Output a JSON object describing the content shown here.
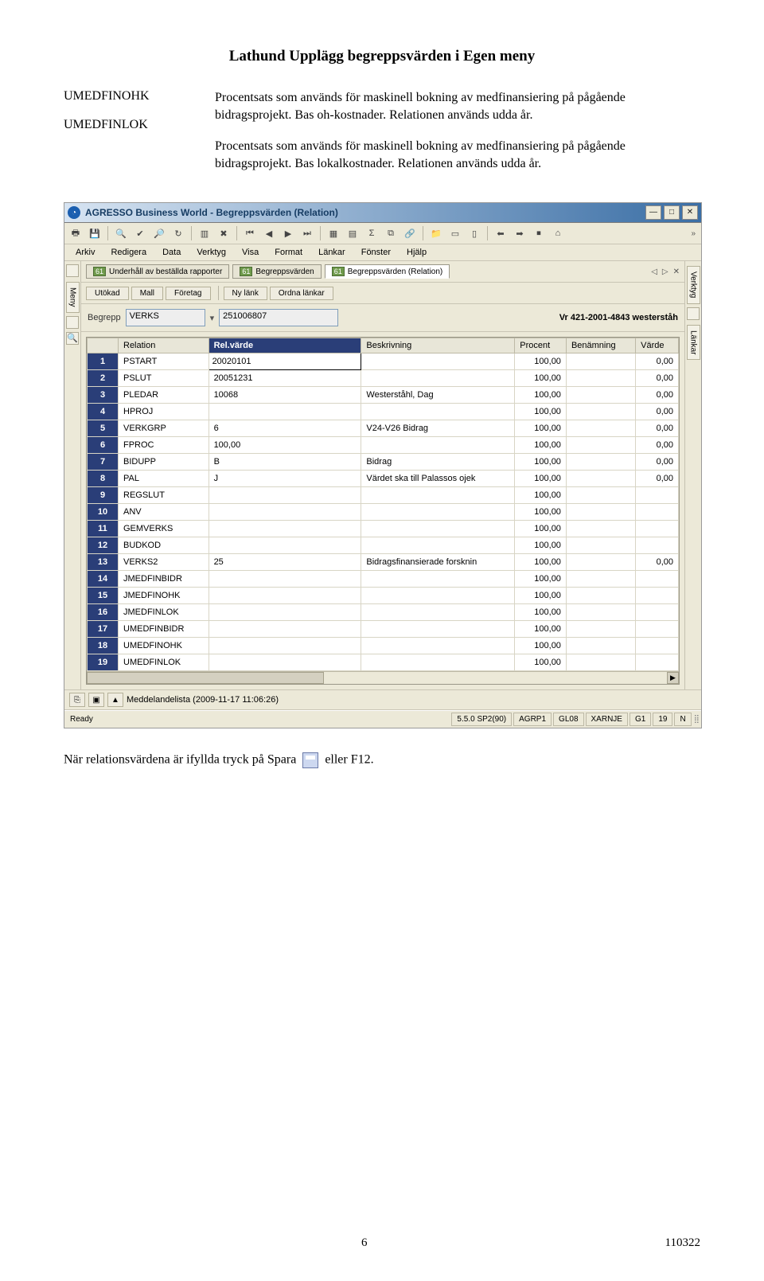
{
  "doc": {
    "title": "Lathund Upplägg begreppsvärden i Egen meny",
    "defs": [
      {
        "label": "UMEDFINOHK",
        "text": "Procentsats som används för maskinell bokning av medfinansiering på pågående bidragsprojekt. Bas oh-kostnader. Relationen används udda år."
      },
      {
        "label": "UMEDFINLOK",
        "text": "Procentsats som används för maskinell bokning av medfinansiering på pågående bidragsprojekt. Bas lokalkostnader. Relationen används udda år."
      }
    ],
    "after_text_1": "När relationsvärdena är ifyllda tryck på Spara",
    "after_text_2": "eller F12.",
    "page_num": "6",
    "date": "110322"
  },
  "app": {
    "window_title": "AGRESSO Business World - Begreppsvärden (Relation)",
    "menubar": [
      "Arkiv",
      "Redigera",
      "Data",
      "Verktyg",
      "Visa",
      "Format",
      "Länkar",
      "Fönster",
      "Hjälp"
    ],
    "side_left_label": "Meny",
    "side_right_labels": [
      "Verktyg",
      "Länkar"
    ],
    "tabs": [
      {
        "label": "Underhåll av beställda rapporter",
        "selected": false
      },
      {
        "label": "Begreppsvärden",
        "selected": false
      },
      {
        "label": "Begreppsvärden (Relation)",
        "selected": true
      }
    ],
    "inner_toolbar": [
      "Utökad",
      "Mall",
      "Företag",
      "Ny länk",
      "Ordna länkar"
    ],
    "begrepp": {
      "label": "Begrepp",
      "field1": "VERKS",
      "field2": "251006807",
      "desc": "Vr 421-2001-4843 westerståh"
    },
    "columns": [
      "",
      "Relation",
      "Rel.värde",
      "Beskrivning",
      "Procent",
      "Benämning",
      "Värde"
    ],
    "sorted_col_index": 2,
    "rows": [
      {
        "n": "1",
        "rel": "PSTART",
        "val": "20020101",
        "besk": "",
        "proc": "100,00",
        "ben": "",
        "varde": "0,00",
        "edit": true
      },
      {
        "n": "2",
        "rel": "PSLUT",
        "val": "20051231",
        "besk": "",
        "proc": "100,00",
        "ben": "",
        "varde": "0,00"
      },
      {
        "n": "3",
        "rel": "PLEDAR",
        "val": "10068",
        "besk": "Westerståhl, Dag",
        "proc": "100,00",
        "ben": "",
        "varde": "0,00"
      },
      {
        "n": "4",
        "rel": "HPROJ",
        "val": "",
        "besk": "",
        "proc": "100,00",
        "ben": "",
        "varde": "0,00"
      },
      {
        "n": "5",
        "rel": "VERKGRP",
        "val": "6",
        "besk": "V24-V26 Bidrag",
        "proc": "100,00",
        "ben": "",
        "varde": "0,00"
      },
      {
        "n": "6",
        "rel": "FPROC",
        "val": "100,00",
        "besk": "",
        "proc": "100,00",
        "ben": "",
        "varde": "0,00"
      },
      {
        "n": "7",
        "rel": "BIDUPP",
        "val": "B",
        "besk": "Bidrag",
        "proc": "100,00",
        "ben": "",
        "varde": "0,00"
      },
      {
        "n": "8",
        "rel": "PAL",
        "val": "J",
        "besk": "Värdet ska till Palassos ojek",
        "proc": "100,00",
        "ben": "",
        "varde": "0,00"
      },
      {
        "n": "9",
        "rel": "REGSLUT",
        "val": "",
        "besk": "",
        "proc": "100,00",
        "ben": "",
        "varde": ""
      },
      {
        "n": "10",
        "rel": "ANV",
        "val": "",
        "besk": "",
        "proc": "100,00",
        "ben": "",
        "varde": ""
      },
      {
        "n": "11",
        "rel": "GEMVERKS",
        "val": "",
        "besk": "",
        "proc": "100,00",
        "ben": "",
        "varde": ""
      },
      {
        "n": "12",
        "rel": "BUDKOD",
        "val": "",
        "besk": "",
        "proc": "100,00",
        "ben": "",
        "varde": ""
      },
      {
        "n": "13",
        "rel": "VERKS2",
        "val": "25",
        "besk": "Bidragsfinansierade forsknin",
        "proc": "100,00",
        "ben": "",
        "varde": "0,00"
      },
      {
        "n": "14",
        "rel": "JMEDFINBIDR",
        "val": "",
        "besk": "",
        "proc": "100,00",
        "ben": "",
        "varde": ""
      },
      {
        "n": "15",
        "rel": "JMEDFINOHK",
        "val": "",
        "besk": "",
        "proc": "100,00",
        "ben": "",
        "varde": ""
      },
      {
        "n": "16",
        "rel": "JMEDFINLOK",
        "val": "",
        "besk": "",
        "proc": "100,00",
        "ben": "",
        "varde": ""
      },
      {
        "n": "17",
        "rel": "UMEDFINBIDR",
        "val": "",
        "besk": "",
        "proc": "100,00",
        "ben": "",
        "varde": ""
      },
      {
        "n": "18",
        "rel": "UMEDFINOHK",
        "val": "",
        "besk": "",
        "proc": "100,00",
        "ben": "",
        "varde": ""
      },
      {
        "n": "19",
        "rel": "UMEDFINLOK",
        "val": "",
        "besk": "",
        "proc": "100,00",
        "ben": "",
        "varde": ""
      }
    ],
    "msgbar_label": "Meddelandelista (2009-11-17 11:06:26)",
    "status": {
      "ready": "Ready",
      "cells": [
        "5.5.0 SP2(90)",
        "AGRP1",
        "GL08",
        "XARNJE",
        "G1",
        "19",
        "N"
      ]
    }
  }
}
